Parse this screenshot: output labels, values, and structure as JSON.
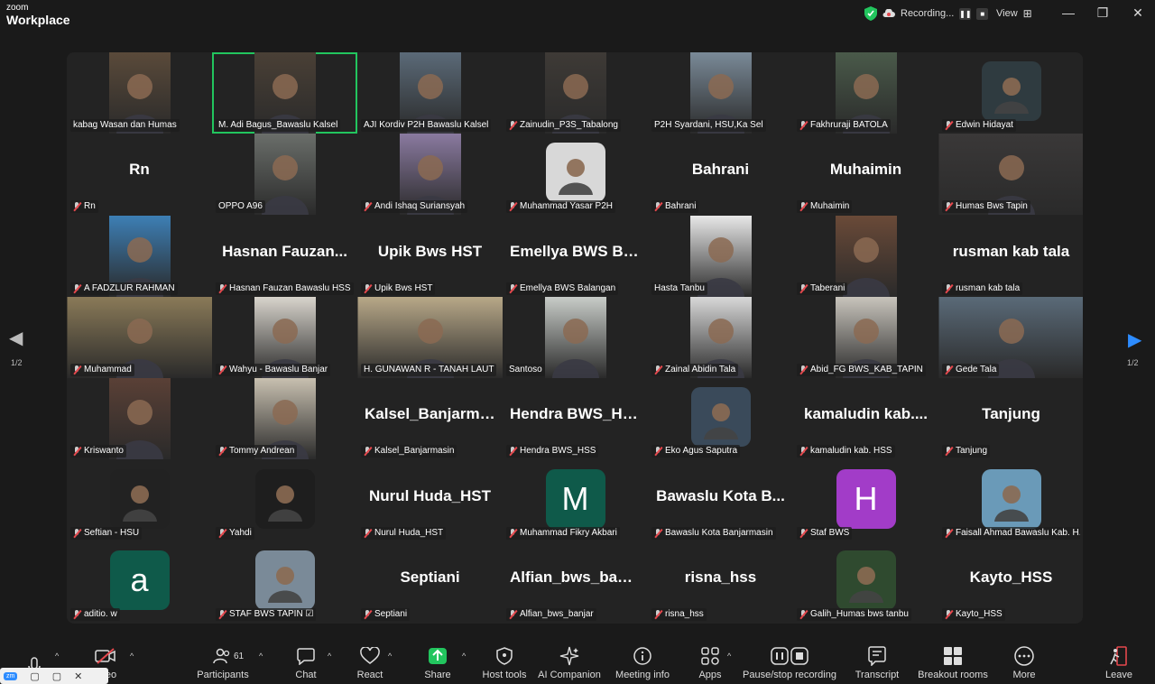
{
  "app": {
    "brand_small": "zoom",
    "brand_large": "Workplace"
  },
  "recording": {
    "label": "Recording...",
    "view_label": "View"
  },
  "paging": {
    "left_page": "1/2",
    "right_page": "1/2"
  },
  "tiles": [
    {
      "name": "kabag Wasan dan Humas",
      "muted": false,
      "kind": "photo",
      "color": "#5a4a3a"
    },
    {
      "name": "M. Adi Bagus_Bawaslu Kalsel",
      "muted": false,
      "kind": "photo",
      "color": "#4a4036",
      "active": true
    },
    {
      "name": "AJI Kordiv P2H Bawaslu Kalsel",
      "muted": false,
      "kind": "photo",
      "color": "#5b6a78"
    },
    {
      "name": "Zainudin_P3S_Tabalong",
      "muted": true,
      "kind": "photo",
      "color": "#3e3a36"
    },
    {
      "name": "P2H Syardani, HSU,Ka Sel",
      "muted": false,
      "kind": "photo",
      "color": "#7a8a98"
    },
    {
      "name": "Fakhruraji BATOLA",
      "muted": true,
      "kind": "photo",
      "color": "#4a5a4a"
    },
    {
      "name": "Edwin Hidayat",
      "muted": true,
      "kind": "avatar",
      "color": "#2f3b40",
      "initial": ""
    },
    {
      "name": "Rn",
      "muted": true,
      "kind": "text",
      "big": "Rn"
    },
    {
      "name": "OPPO A96",
      "muted": false,
      "kind": "photo",
      "color": "#6a6e6a"
    },
    {
      "name": "Andi Ishaq Suriansyah",
      "muted": true,
      "kind": "photo",
      "color": "#8a7aa0"
    },
    {
      "name": "Muhammad Yasar P2H",
      "muted": true,
      "kind": "avatar",
      "color": "#d8d8d8",
      "initial": ""
    },
    {
      "name": "Bahrani",
      "muted": true,
      "kind": "text",
      "big": "Bahrani"
    },
    {
      "name": "Muhaimin",
      "muted": true,
      "kind": "text",
      "big": "Muhaimin"
    },
    {
      "name": "Humas Bws Tapin",
      "muted": true,
      "kind": "photo",
      "color": "#3a3838",
      "wide": true
    },
    {
      "name": "A FADZLUR RAHMAN",
      "muted": true,
      "kind": "photo",
      "color": "#3d7fb5"
    },
    {
      "name": "Hasnan Fauzan Bawaslu HSS",
      "muted": true,
      "kind": "text",
      "big": "Hasnan Fauzan..."
    },
    {
      "name": "Upik Bws HST",
      "muted": true,
      "kind": "text",
      "big": "Upik Bws HST"
    },
    {
      "name": "Emellya BWS Balangan",
      "muted": true,
      "kind": "text",
      "big": "Emellya BWS Ba..."
    },
    {
      "name": "Hasta Tanbu",
      "muted": false,
      "kind": "photo",
      "color": "#e8e8e8"
    },
    {
      "name": "Taberani",
      "muted": true,
      "kind": "photo",
      "color": "#6a4a38"
    },
    {
      "name": "rusman kab tala",
      "muted": true,
      "kind": "text",
      "big": "rusman kab tala"
    },
    {
      "name": "Muhammad",
      "muted": true,
      "kind": "photo",
      "color": "#8a7a58",
      "wide": true
    },
    {
      "name": "Wahyu - Bawaslu Banjar",
      "muted": true,
      "kind": "photo",
      "color": "#d8d4cc"
    },
    {
      "name": "H. GUNAWAN R - TANAH LAUT",
      "muted": false,
      "kind": "photo",
      "color": "#b8a888",
      "wide": true
    },
    {
      "name": "Santoso",
      "muted": false,
      "kind": "photo",
      "color": "#c8ccc8"
    },
    {
      "name": "Zainal Abidin Tala",
      "muted": true,
      "kind": "photo",
      "color": "#d8d8d8"
    },
    {
      "name": "Abid_FG BWS_KAB_TAPIN",
      "muted": true,
      "kind": "photo",
      "color": "#c8c4bc"
    },
    {
      "name": "Gede Tala",
      "muted": true,
      "kind": "photo",
      "color": "#5a6a78",
      "wide": true
    },
    {
      "name": "Kriswanto",
      "muted": true,
      "kind": "photo",
      "color": "#5a4036"
    },
    {
      "name": "Tommy Andrean",
      "muted": true,
      "kind": "photo",
      "color": "#c8c0b0"
    },
    {
      "name": "Kalsel_Banjarmasin",
      "muted": true,
      "kind": "text",
      "big": "Kalsel_Banjarma..."
    },
    {
      "name": "Hendra BWS_HSS",
      "muted": true,
      "kind": "text",
      "big": "Hendra BWS_HSS"
    },
    {
      "name": "Eko Agus Saputra",
      "muted": true,
      "kind": "avatar",
      "color": "#3a4a5a",
      "initial": ""
    },
    {
      "name": "kamaludin kab. HSS",
      "muted": true,
      "kind": "text",
      "big": "kamaludin kab...."
    },
    {
      "name": "Tanjung",
      "muted": true,
      "kind": "text",
      "big": "Tanjung"
    },
    {
      "name": "Seftian - HSU",
      "muted": true,
      "kind": "avatar",
      "color": "#222222",
      "initial": ""
    },
    {
      "name": "Yahdi",
      "muted": true,
      "kind": "avatar",
      "color": "#1e1e1e",
      "initial": ""
    },
    {
      "name": "Nurul Huda_HST",
      "muted": true,
      "kind": "text",
      "big": "Nurul Huda_HST"
    },
    {
      "name": "Muhammad Fikry Akbari",
      "muted": true,
      "kind": "avatar",
      "color": "#0f5a4a",
      "initial": "M"
    },
    {
      "name": "Bawaslu Kota Banjarmasin",
      "muted": true,
      "kind": "text",
      "big": "Bawaslu Kota B..."
    },
    {
      "name": "Staf BWS",
      "muted": true,
      "kind": "avatar",
      "color": "#a23cc8",
      "initial": "H"
    },
    {
      "name": "Faisall Ahmad Bawaslu Kab. H...",
      "muted": true,
      "kind": "avatar",
      "color": "#6a9ab8",
      "initial": ""
    },
    {
      "name": "aditio. w",
      "muted": true,
      "kind": "avatar",
      "color": "#0f5a4a",
      "initial": "a"
    },
    {
      "name": "STAF BWS TAPIN ☑",
      "muted": true,
      "kind": "avatar",
      "color": "#7a8a98",
      "initial": ""
    },
    {
      "name": "Septiani",
      "muted": true,
      "kind": "text",
      "big": "Septiani"
    },
    {
      "name": "Alfian_bws_banjar",
      "muted": true,
      "kind": "text",
      "big": "Alfian_bws_banjar"
    },
    {
      "name": "risna_hss",
      "muted": true,
      "kind": "text",
      "big": "risna_hss"
    },
    {
      "name": "Galih_Humas bws tanbu",
      "muted": true,
      "kind": "avatar",
      "color": "#2f4a2f",
      "initial": ""
    },
    {
      "name": "Kayto_HSS",
      "muted": true,
      "kind": "text",
      "big": "Kayto_HSS"
    }
  ],
  "toolbar": {
    "participants_count": "61",
    "items": [
      {
        "label": "Participants"
      },
      {
        "label": "Chat"
      },
      {
        "label": "React"
      },
      {
        "label": "Share"
      },
      {
        "label": "Host tools"
      },
      {
        "label": "AI Companion"
      },
      {
        "label": "Meeting info"
      },
      {
        "label": "Apps"
      },
      {
        "label": "Pause/stop recording"
      },
      {
        "label": "Transcript"
      },
      {
        "label": "Breakout rooms"
      },
      {
        "label": "More"
      },
      {
        "label": "Leave"
      }
    ],
    "video_label_fragment": "eo"
  },
  "colors": {
    "active_border": "#22c55e",
    "share_green": "#22c55e",
    "mic_red": "#e5484d"
  }
}
